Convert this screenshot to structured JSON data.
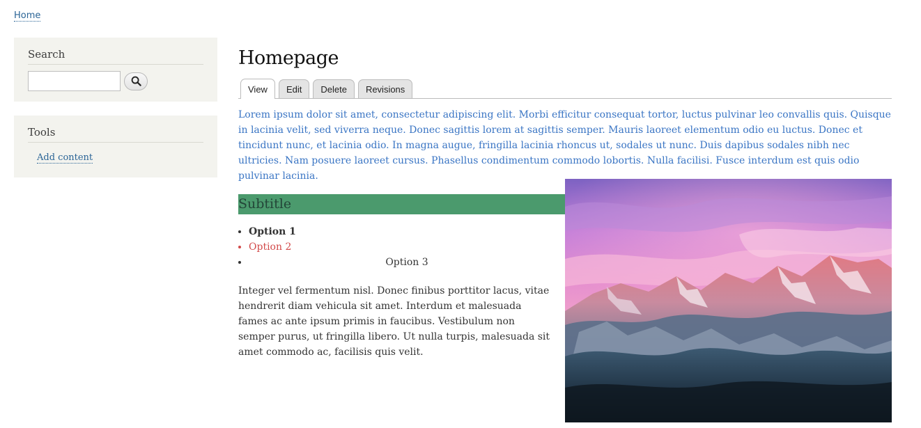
{
  "breadcrumb": {
    "home": "Home"
  },
  "sidebar": {
    "search": {
      "title": "Search",
      "input_value": "",
      "button_icon": "search-icon"
    },
    "tools": {
      "title": "Tools",
      "link": "Add content"
    }
  },
  "main": {
    "title": "Homepage",
    "tabs": [
      {
        "label": "View",
        "active": true
      },
      {
        "label": "Edit",
        "active": false
      },
      {
        "label": "Delete",
        "active": false
      },
      {
        "label": "Revisions",
        "active": false
      }
    ],
    "intro": "Lorem ipsum dolor sit amet, consectetur adipiscing elit. Morbi efficitur consequat tortor, luctus pulvinar leo convallis quis. Quisque in lacinia velit, sed viverra neque. Donec sagittis lorem at sagittis semper. Mauris laoreet elementum odio eu luctus. Donec et tincidunt nunc, et lacinia odio. In magna augue, fringilla lacinia rhoncus ut, sodales ut nunc. Duis dapibus sodales nibh nec ultricies. Nam posuere laoreet cursus. Phasellus condimentum commodo lobortis. Nulla facilisi. Fusce interdum est quis odio pulvinar lacinia.",
    "subtitle": "Subtitle",
    "options": [
      "Option 1",
      "Option 2",
      "Option 3"
    ],
    "body": "Integer vel fermentum nisl. Donec finibus porttitor lacus, vitae hendrerit diam vehicula sit amet. Interdum et malesuada fames ac ante ipsum primis in faucibus. Vestibulum non semper purus, ut fringilla libero. Ut nulla turpis, malesuada sit amet commodo ac, facilisis quis velit.",
    "image": "mountain-sunset-image"
  },
  "colors": {
    "link": "#2a6496",
    "intro_text": "#3a75c4",
    "subtitle_bg": "#4b9a6d",
    "option2": "#d24a4a",
    "sidebar_bg": "#f3f3ee"
  }
}
